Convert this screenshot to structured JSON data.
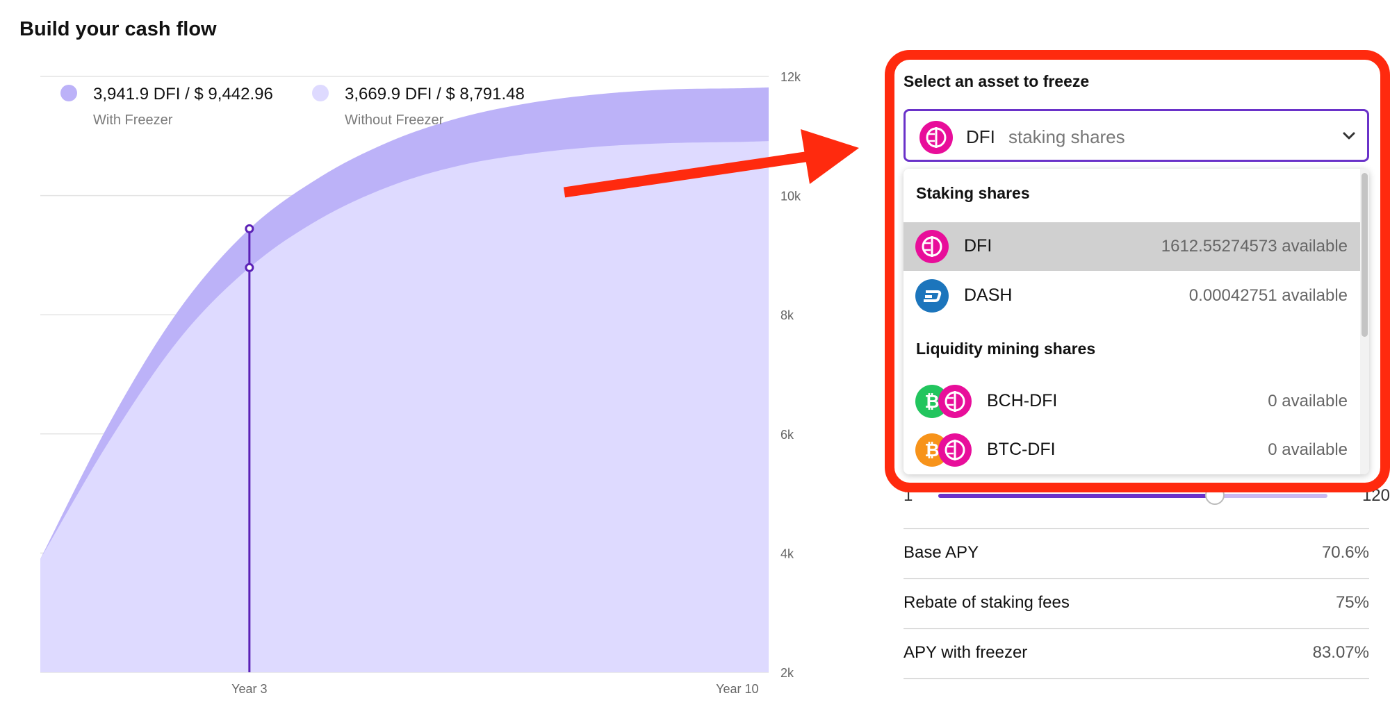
{
  "page": {
    "title": "Build your cash flow"
  },
  "chart": {
    "legend": [
      {
        "value": "3,941.9 DFI / $ 9,442.96",
        "label": "With Freezer",
        "color": "#bcb2f8"
      },
      {
        "value": "3,669.9 DFI / $ 8,791.48",
        "label": "Without Freezer",
        "color": "#dedaff"
      }
    ],
    "y_ticks": [
      "12k",
      "10k",
      "8k",
      "6k",
      "4k",
      "2k"
    ],
    "x_ticks": [
      "Year 3",
      "Year 10"
    ],
    "colors": {
      "with": "#bcb2f8",
      "without": "#dedaff",
      "marker": "#5b21b6"
    }
  },
  "chart_data": {
    "type": "area",
    "title": "Build your cash flow",
    "x_ticks": [
      "Year 3",
      "Year 10"
    ],
    "y_ticks": [
      "2k",
      "4k",
      "6k",
      "8k",
      "10k",
      "12k"
    ],
    "ylim": [
      2000,
      12000
    ],
    "series": [
      {
        "name": "With Freezer",
        "x": [
          0,
          1,
          2,
          3,
          4,
          5,
          6,
          7,
          8,
          9,
          10
        ],
        "values": [
          3900,
          6200,
          8100,
          9440,
          10300,
          10900,
          11300,
          11550,
          11700,
          11780,
          11800
        ]
      },
      {
        "name": "Without Freezer",
        "x": [
          0,
          1,
          2,
          3,
          4,
          5,
          6,
          7,
          8,
          9,
          10
        ],
        "values": [
          3900,
          5900,
          7600,
          8790,
          9600,
          10150,
          10500,
          10700,
          10820,
          10880,
          10900
        ]
      }
    ],
    "marker": {
      "x_label": "Year 3",
      "with": 9442.96,
      "without": 8791.48
    },
    "legend_position": "top-left",
    "grid": true
  },
  "selector": {
    "label": "Select an asset to freeze",
    "selected_symbol": "DFI",
    "selected_sub": "staking shares"
  },
  "dropdown": {
    "staking_header": "Staking shares",
    "staking_items": [
      {
        "name": "DFI",
        "available": "1612.55274573 available",
        "icon": "dfi-icon"
      },
      {
        "name": "DASH",
        "available": "0.00042751 available",
        "icon": "dash-icon"
      }
    ],
    "liquidity_header": "Liquidity mining shares",
    "liquidity_items": [
      {
        "name": "BCH-DFI",
        "available": "0 available",
        "icons": [
          "bch-icon",
          "dfi-icon"
        ]
      },
      {
        "name": "BTC-DFI",
        "available": "0 available",
        "icons": [
          "btc-icon",
          "dfi-icon"
        ]
      }
    ]
  },
  "slider": {
    "min_label": "1",
    "max_label": "120",
    "fraction": 0.71
  },
  "stats": [
    {
      "label": "Base APY",
      "value": "70.6%"
    },
    {
      "label": "Rebate of staking fees",
      "value": "75%"
    },
    {
      "label": "APY with freezer",
      "value": "83.07%"
    }
  ],
  "colors": {
    "accent": "#6a32c9",
    "annotation": "#ff2a0e",
    "dfi": "#e80e9a",
    "dash": "#1c75bc",
    "bch": "#22c55e",
    "btc": "#f7931a"
  }
}
